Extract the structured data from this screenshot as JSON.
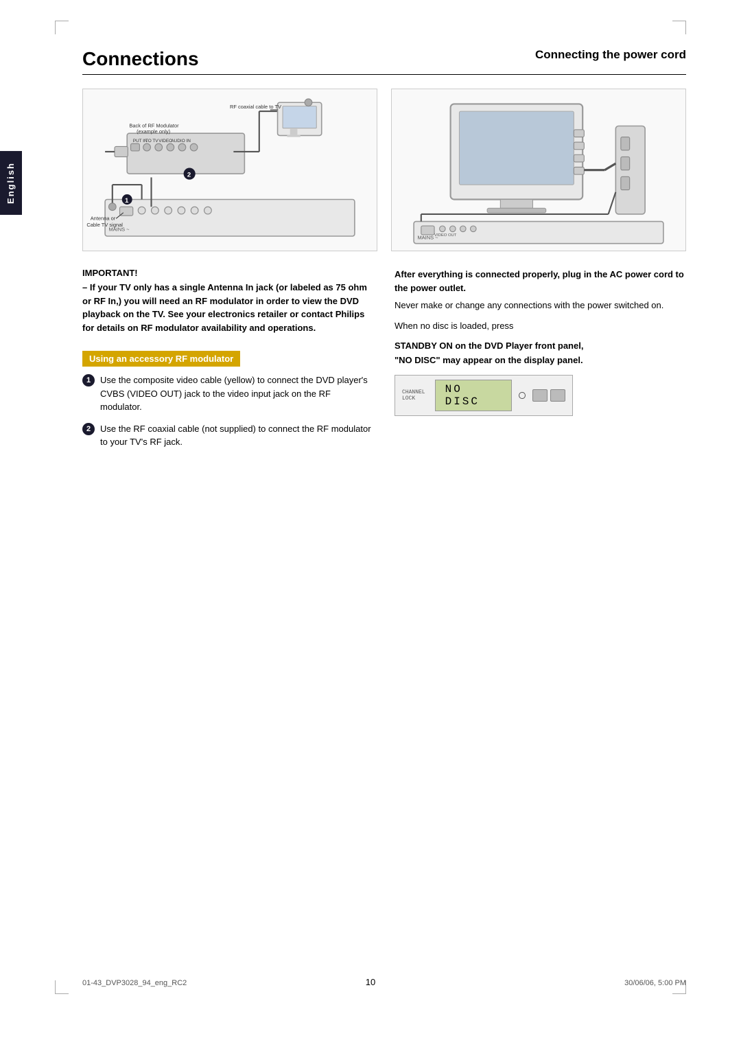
{
  "page": {
    "title": "Connections",
    "english_tab": "English",
    "page_number": "10",
    "footer_left": "01-43_DVP3028_94_eng_RC2",
    "footer_center": "10",
    "footer_right": "30/06/06, 5:00 PM"
  },
  "sections": {
    "connecting_power": {
      "heading": "Connecting the power cord"
    },
    "important": {
      "label": "IMPORTANT!",
      "text_parts": [
        "– If your TV only has a single Antenna In jack (or labeled as 75 ohm or RF In,) you will need an RF modulator in order to view the DVD playback on the TV. See your electronics retailer or contact Philips for details on RF modulator availability and operations."
      ]
    },
    "rf_modulator": {
      "box_label": "Using an accessory RF modulator",
      "steps": [
        "Use the composite video cable (yellow) to connect the DVD player's CVBS (VIDEO OUT) jack to the video input jack on the RF modulator.",
        "Use the RF coaxial cable (not supplied) to connect the RF modulator to your TV's RF jack."
      ]
    },
    "right_column": {
      "heading1": "After everything is connected properly, plug in the AC power cord to the power outlet.",
      "text1": "Never make or change any connections with the power switched on.",
      "text2": "When no disc is loaded, press",
      "heading2": "STANDBY ON on the DVD Player front panel,",
      "heading3": "\"NO DISC\" may appear on the display panel.",
      "display": {
        "screen_text": "NO DISC",
        "left_label": "CHANNEL LOCK"
      }
    }
  },
  "diagrams": {
    "left": {
      "labels": {
        "rf_coax": "RF coaxial cable to TV",
        "back_rf": "Back of RF Modulator",
        "example": "(example only)",
        "antenna": "Antenna or",
        "cable_tv": "Cable TV signal"
      }
    },
    "right": {
      "labels": {}
    }
  }
}
